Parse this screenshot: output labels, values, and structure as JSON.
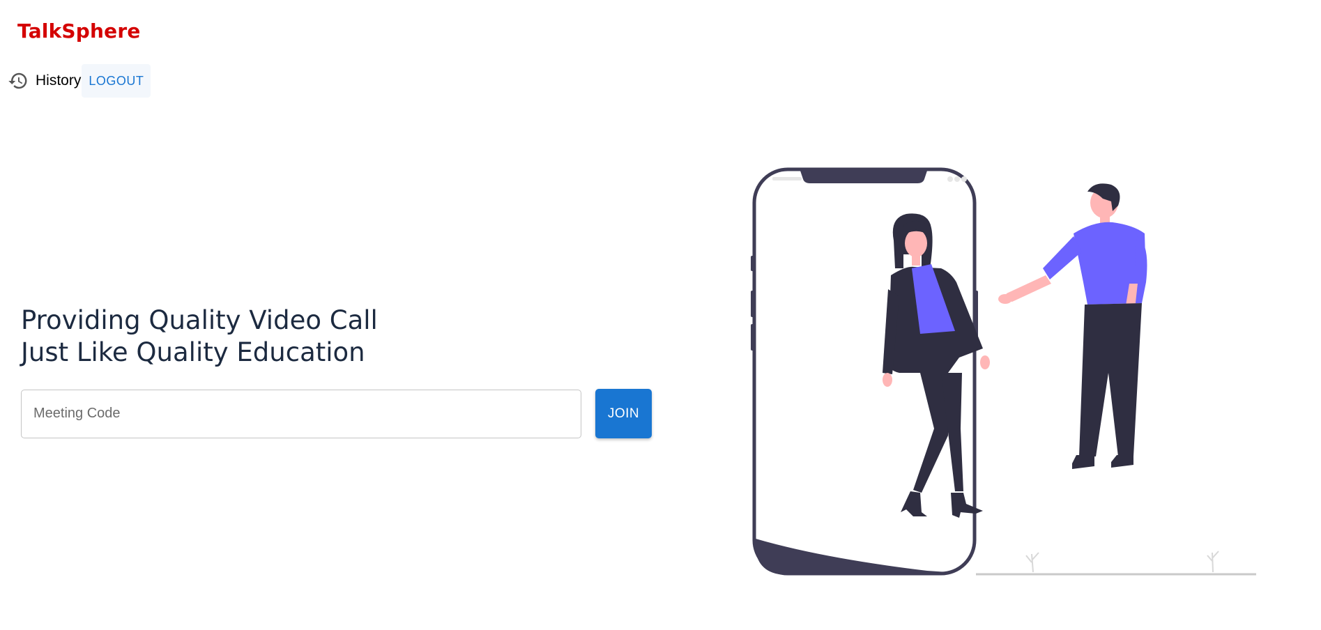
{
  "header": {
    "brand": "TalkSphere",
    "history_label": "History",
    "logout_label": "LOGOUT",
    "history_icon": "history-icon"
  },
  "main": {
    "headline_line1": "Providing Quality Video Call",
    "headline_line2": "Just Like Quality Education",
    "meeting_code_placeholder": "Meeting Code",
    "meeting_code_value": "",
    "join_label": "JOIN"
  },
  "colors": {
    "brand": "#d40000",
    "primary": "#1976d2",
    "headline": "#1c2a40",
    "accent_purple": "#6c63ff",
    "dark": "#2f2e41",
    "skin": "#ffb6b6"
  }
}
